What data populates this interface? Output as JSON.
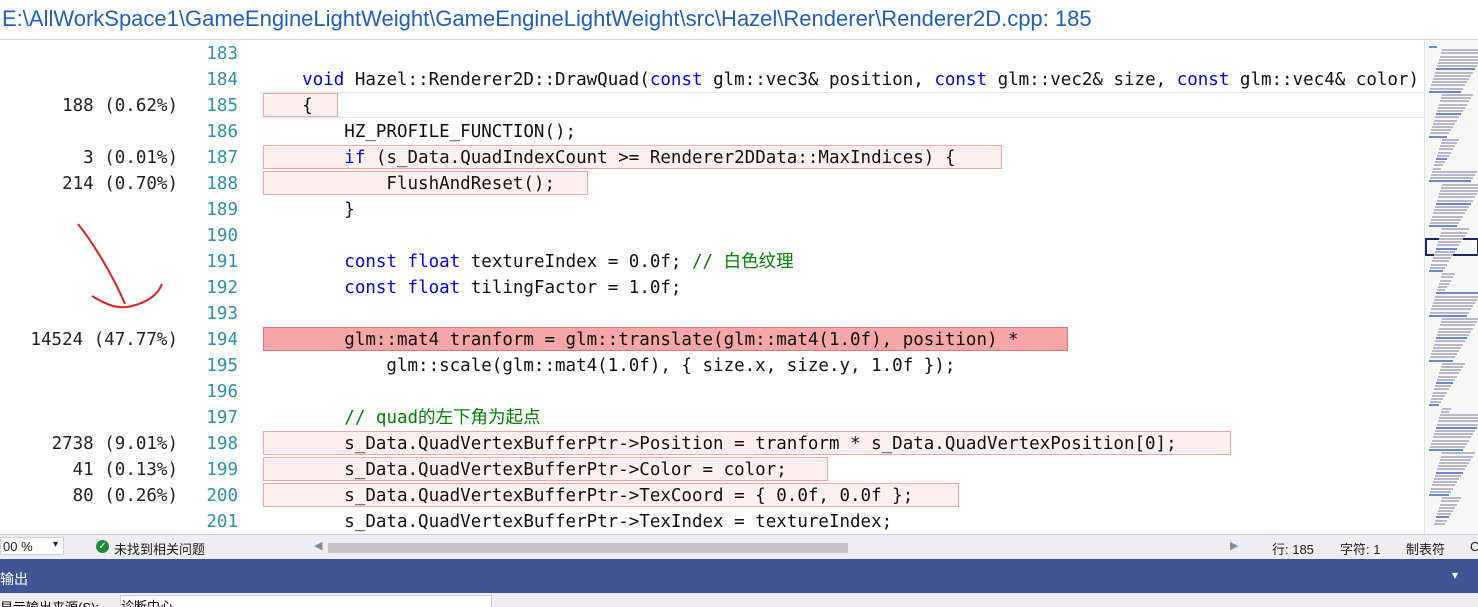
{
  "title": "E:\\AllWorkSpace1\\GameEngineLightWeight\\GameEngineLightWeight\\src\\Hazel\\Renderer\\Renderer2D.cpp: 185",
  "lines": [
    {
      "num": "183",
      "count": "",
      "code": []
    },
    {
      "num": "184",
      "count": "",
      "code": [
        {
          "t": "    "
        },
        {
          "t": "void",
          "c": "kw"
        },
        {
          "t": " Hazel::Renderer2D::DrawQuad("
        },
        {
          "t": "const",
          "c": "kw"
        },
        {
          "t": " glm::vec3& position, "
        },
        {
          "t": "const",
          "c": "kw"
        },
        {
          "t": " glm::vec2& size, "
        },
        {
          "t": "const",
          "c": "kw"
        },
        {
          "t": " glm::vec4& color)"
        }
      ]
    },
    {
      "num": "185",
      "count": "188 (0.62%)",
      "code": [
        {
          "t": "    {"
        }
      ]
    },
    {
      "num": "186",
      "count": "",
      "code": [
        {
          "t": "        HZ_PROFILE_FUNCTION();"
        }
      ]
    },
    {
      "num": "187",
      "count": "3 (0.01%)",
      "code": [
        {
          "t": "        "
        },
        {
          "t": "if",
          "c": "kw"
        },
        {
          "t": " (s_Data.QuadIndexCount >= Renderer2DData::MaxIndices) {"
        }
      ]
    },
    {
      "num": "188",
      "count": "214 (0.70%)",
      "code": [
        {
          "t": "            FlushAndReset();"
        }
      ]
    },
    {
      "num": "189",
      "count": "",
      "code": [
        {
          "t": "        }"
        }
      ]
    },
    {
      "num": "190",
      "count": "",
      "code": []
    },
    {
      "num": "191",
      "count": "",
      "code": [
        {
          "t": "        "
        },
        {
          "t": "const",
          "c": "kw"
        },
        {
          "t": " "
        },
        {
          "t": "float",
          "c": "kw"
        },
        {
          "t": " textureIndex = 0.0f; "
        },
        {
          "t": "// 白色纹理",
          "c": "cm"
        }
      ]
    },
    {
      "num": "192",
      "count": "",
      "code": [
        {
          "t": "        "
        },
        {
          "t": "const",
          "c": "kw"
        },
        {
          "t": " "
        },
        {
          "t": "float",
          "c": "kw"
        },
        {
          "t": " tilingFactor = 1.0f;"
        }
      ]
    },
    {
      "num": "193",
      "count": "",
      "code": []
    },
    {
      "num": "194",
      "count": "14524 (47.77%)",
      "code": [
        {
          "t": "        glm::mat4 tranform = glm::translate(glm::mat4(1.0f), position) *"
        }
      ]
    },
    {
      "num": "195",
      "count": "",
      "code": [
        {
          "t": "            glm::scale(glm::mat4(1.0f), { size.x, size.y, 1.0f });"
        }
      ]
    },
    {
      "num": "196",
      "count": "",
      "code": []
    },
    {
      "num": "197",
      "count": "",
      "code": [
        {
          "t": "        "
        },
        {
          "t": "// quad的左下角为起点",
          "c": "cm"
        }
      ]
    },
    {
      "num": "198",
      "count": "2738 (9.01%)",
      "code": [
        {
          "t": "        s_Data.QuadVertexBufferPtr->Position = tranform * s_Data.QuadVertexPosition[0];"
        }
      ]
    },
    {
      "num": "199",
      "count": "41 (0.13%)",
      "code": [
        {
          "t": "        s_Data.QuadVertexBufferPtr->Color = color;"
        }
      ]
    },
    {
      "num": "200",
      "count": "80 (0.26%)",
      "code": [
        {
          "t": "        s_Data.QuadVertexBufferPtr->TexCoord = { 0.0f, 0.0f };"
        }
      ]
    },
    {
      "num": "201",
      "count": "",
      "code": [
        {
          "t": "        s_Data.QuadVertexBufferPtr->TexIndex = textureIndex;"
        }
      ]
    }
  ],
  "highlights": [
    {
      "line": 2,
      "hot": false
    },
    {
      "line": 4,
      "hot": false
    },
    {
      "line": 5,
      "hot": false
    },
    {
      "line": 11,
      "hot": true
    },
    {
      "line": 15,
      "hot": false
    },
    {
      "line": 16,
      "hot": false
    },
    {
      "line": 17,
      "hot": false
    }
  ],
  "status": {
    "zoom": "00 %",
    "issues": "未找到相关问题",
    "line": "行: 185",
    "char": "字符: 1",
    "tab": "制表符",
    "crlf": "C"
  },
  "output_panel": {
    "title": "输出",
    "source_label": "显示输出来源(S):",
    "source_value": "诊断中心"
  },
  "colors": {
    "keyword": "#0000ff",
    "comment": "#008000",
    "line_number": "#2b91af",
    "hot_highlight": "#f6a6a6",
    "warm_highlight": "#fff0f0",
    "annotation": "#e02020"
  }
}
